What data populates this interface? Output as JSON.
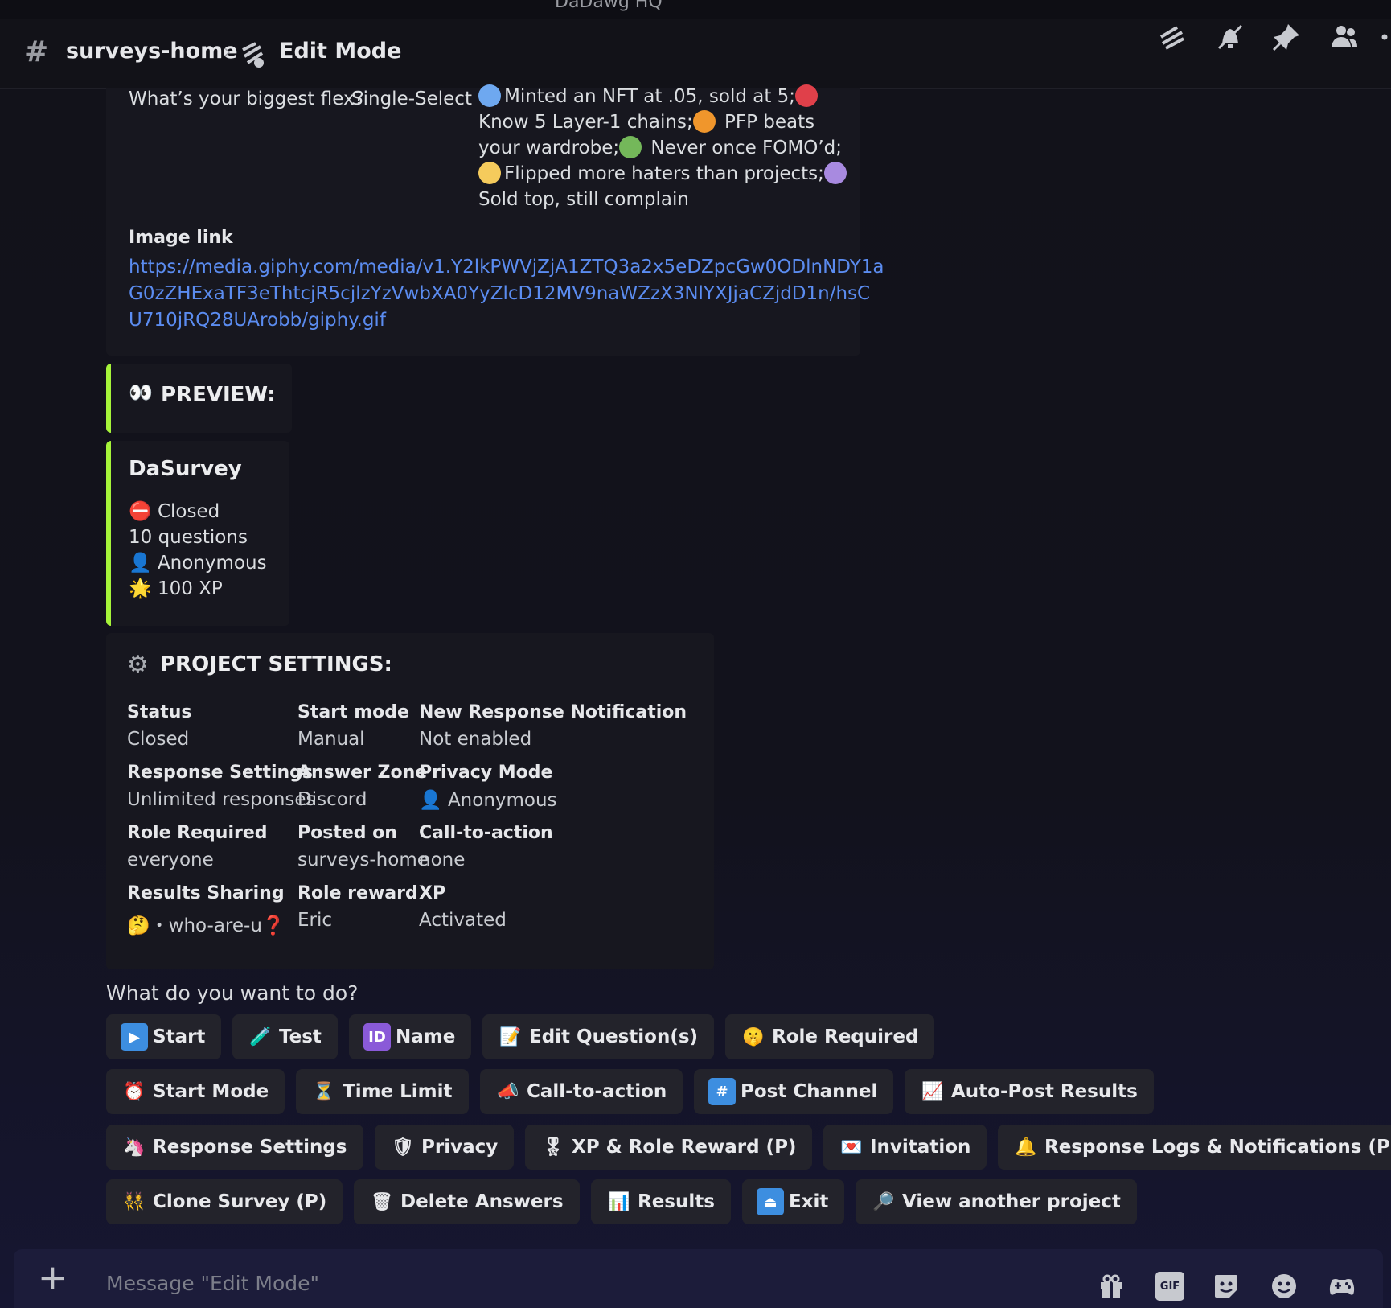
{
  "server_name": "DaDawg HQ",
  "header": {
    "channel": "surveys-home",
    "separator": "›",
    "thread": "Edit Mode"
  },
  "question": {
    "text": "What’s your biggest flex?",
    "type": "Single-Select",
    "options_lines": [
      {
        "parts": [
          {
            "dot": "#6ea8f0"
          },
          {
            "text": "Minted an NFT at .05, sold at 5;"
          },
          {
            "dot": "#e0404a"
          }
        ]
      },
      {
        "parts": [
          {
            "text": "Know 5 Layer-1 chains;"
          },
          {
            "dot": "#f0962c"
          },
          {
            "text": " PFP beats"
          }
        ]
      },
      {
        "parts": [
          {
            "text": "your wardrobe;"
          },
          {
            "dot": "#74b85a"
          },
          {
            "text": " Never once FOMO’d;"
          }
        ]
      },
      {
        "parts": [
          {
            "dot": "#f5cb5c"
          },
          {
            "text": "Flipped more haters than projects;"
          },
          {
            "dot": "#a88ae0"
          }
        ]
      },
      {
        "parts": [
          {
            "text": "Sold top, still complain"
          }
        ]
      }
    ]
  },
  "image_link": {
    "label": "Image link",
    "lines": [
      "https://media.giphy.com/media/v1.Y2lkPWVjZjA1ZTQ3a2x5eDZpcGw0ODlnNDY1a",
      "G0zZHExaTF3eThtcjR5cjlzYzVwbXA0YyZlcD12MV9naWZzX3NlYXJjaCZjdD1n/hsC",
      "U710jRQ28UArobb/giphy.gif"
    ]
  },
  "preview": {
    "icon": "👀",
    "title": "PREVIEW:"
  },
  "survey_card": {
    "title": "DaSurvey",
    "lines": [
      {
        "icon": "⛔",
        "text": "Closed"
      },
      {
        "icon": "",
        "text": "10 questions"
      },
      {
        "icon": "👤",
        "text": "Anonymous"
      },
      {
        "icon": "🌟",
        "text": "100 XP"
      }
    ]
  },
  "settings": {
    "icon": "⚙",
    "title": "PROJECT SETTINGS:",
    "rows": [
      [
        {
          "label": "Status",
          "value": "Closed"
        },
        {
          "label": "Start mode",
          "value": "Manual"
        },
        {
          "label": "New Response Notification",
          "value": "Not enabled"
        }
      ],
      [
        {
          "label": "Response Settings",
          "value": "Unlimited responses"
        },
        {
          "label": "Answer Zone",
          "value": "Discord"
        },
        {
          "label": "Privacy Mode",
          "value": "👤 Anonymous"
        }
      ],
      [
        {
          "label": "Role Required",
          "value": "everyone"
        },
        {
          "label": "Posted on",
          "value": "surveys-home"
        },
        {
          "label": "Call-to-action",
          "value": "none"
        }
      ],
      [
        {
          "label": "Results Sharing",
          "value": "🤔・who-are-u❓"
        },
        {
          "label": "Role reward",
          "value": "Eric"
        },
        {
          "label": "XP",
          "value": "Activated"
        }
      ]
    ]
  },
  "prompt": "What do you want to do?",
  "buttons": [
    [
      {
        "icon": "▶",
        "icon_bg": "#3d8ee0",
        "label": "Start",
        "name": "start"
      },
      {
        "icon": "🧪",
        "icon_bg": "",
        "label": "Test",
        "name": "test"
      },
      {
        "icon": "ID",
        "icon_bg": "#8a5ad8",
        "label": "Name",
        "name": "name"
      },
      {
        "icon": "📝",
        "icon_bg": "",
        "label": "Edit Question(s)",
        "name": "edit-questions"
      },
      {
        "icon": "🤫",
        "icon_bg": "",
        "label": "Role Required",
        "name": "role-required"
      }
    ],
    [
      {
        "icon": "⏰",
        "icon_bg": "",
        "label": "Start Mode",
        "name": "start-mode"
      },
      {
        "icon": "⏳",
        "icon_bg": "",
        "label": "Time Limit",
        "name": "time-limit"
      },
      {
        "icon": "📣",
        "icon_bg": "",
        "label": "Call-to-action",
        "name": "call-to-action"
      },
      {
        "icon": "#",
        "icon_bg": "#3d8ee0",
        "label": "Post Channel",
        "name": "post-channel"
      },
      {
        "icon": "📈",
        "icon_bg": "",
        "label": "Auto-Post Results",
        "name": "auto-post-results"
      }
    ],
    [
      {
        "icon": "🦄",
        "icon_bg": "",
        "label": "Response Settings",
        "name": "response-settings"
      },
      {
        "icon": "🛡",
        "icon_bg": "",
        "label": "Privacy",
        "name": "privacy"
      },
      {
        "icon": "🎖",
        "icon_bg": "",
        "label": "XP & Role Reward (P)",
        "name": "xp-role-reward"
      },
      {
        "icon": "💌",
        "icon_bg": "",
        "label": "Invitation",
        "name": "invitation"
      },
      {
        "icon": "🔔",
        "icon_bg": "",
        "label": "Response Logs & Notifications (P)",
        "name": "response-logs"
      }
    ],
    [
      {
        "icon": "👯",
        "icon_bg": "",
        "label": "Clone Survey (P)",
        "name": "clone-survey"
      },
      {
        "icon": "🗑",
        "icon_bg": "",
        "label": "Delete Answers",
        "name": "delete-answers"
      },
      {
        "icon": "📊",
        "icon_bg": "",
        "label": "Results",
        "name": "results"
      },
      {
        "icon": "⏏",
        "icon_bg": "#3d8ee0",
        "label": "Exit",
        "name": "exit"
      },
      {
        "icon": "🔎",
        "icon_bg": "",
        "label": "View another project",
        "name": "view-another-project"
      }
    ]
  ],
  "composer": {
    "placeholder": "Message \"Edit Mode\"",
    "gif_label": "GIF"
  }
}
